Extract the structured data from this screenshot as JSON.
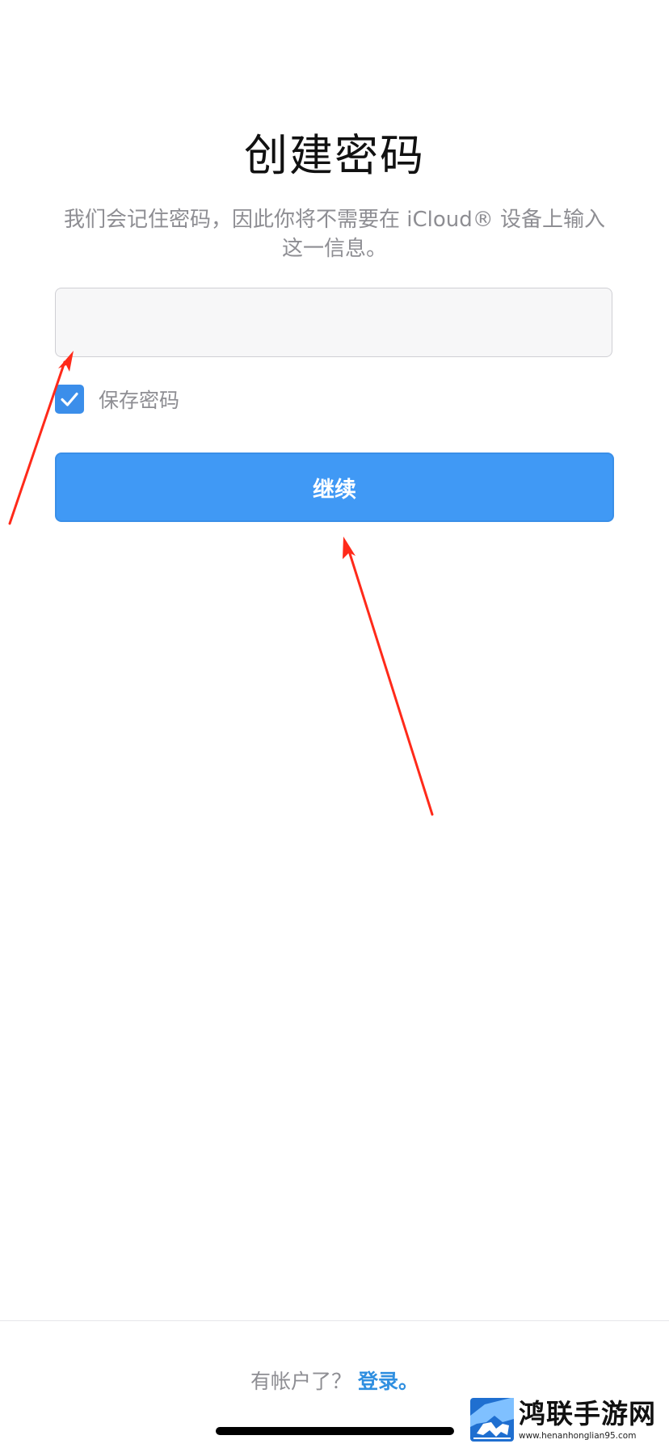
{
  "header": {
    "title": "创建密码",
    "subtitle": "我们会记住密码，因此你将不需要在 iCloud® 设备上输入这一信息。"
  },
  "password_input": {
    "value": "",
    "placeholder": ""
  },
  "save_password": {
    "checked": true,
    "label": "保存密码"
  },
  "continue_button": {
    "label": "继续"
  },
  "footer": {
    "prompt": "有帐户了？",
    "login_link": "登录。"
  },
  "watermark": {
    "name": "鸿联手游网",
    "url": "www.henanhonglian95.com"
  },
  "colors": {
    "accent": "#4099f5",
    "link": "#2f8fe0",
    "secondary_text": "#8e8e93",
    "annotation_arrow": "#ff2a1a"
  },
  "icons": {
    "checkbox": "checkmark-icon",
    "logo": "horse-logo-icon"
  }
}
